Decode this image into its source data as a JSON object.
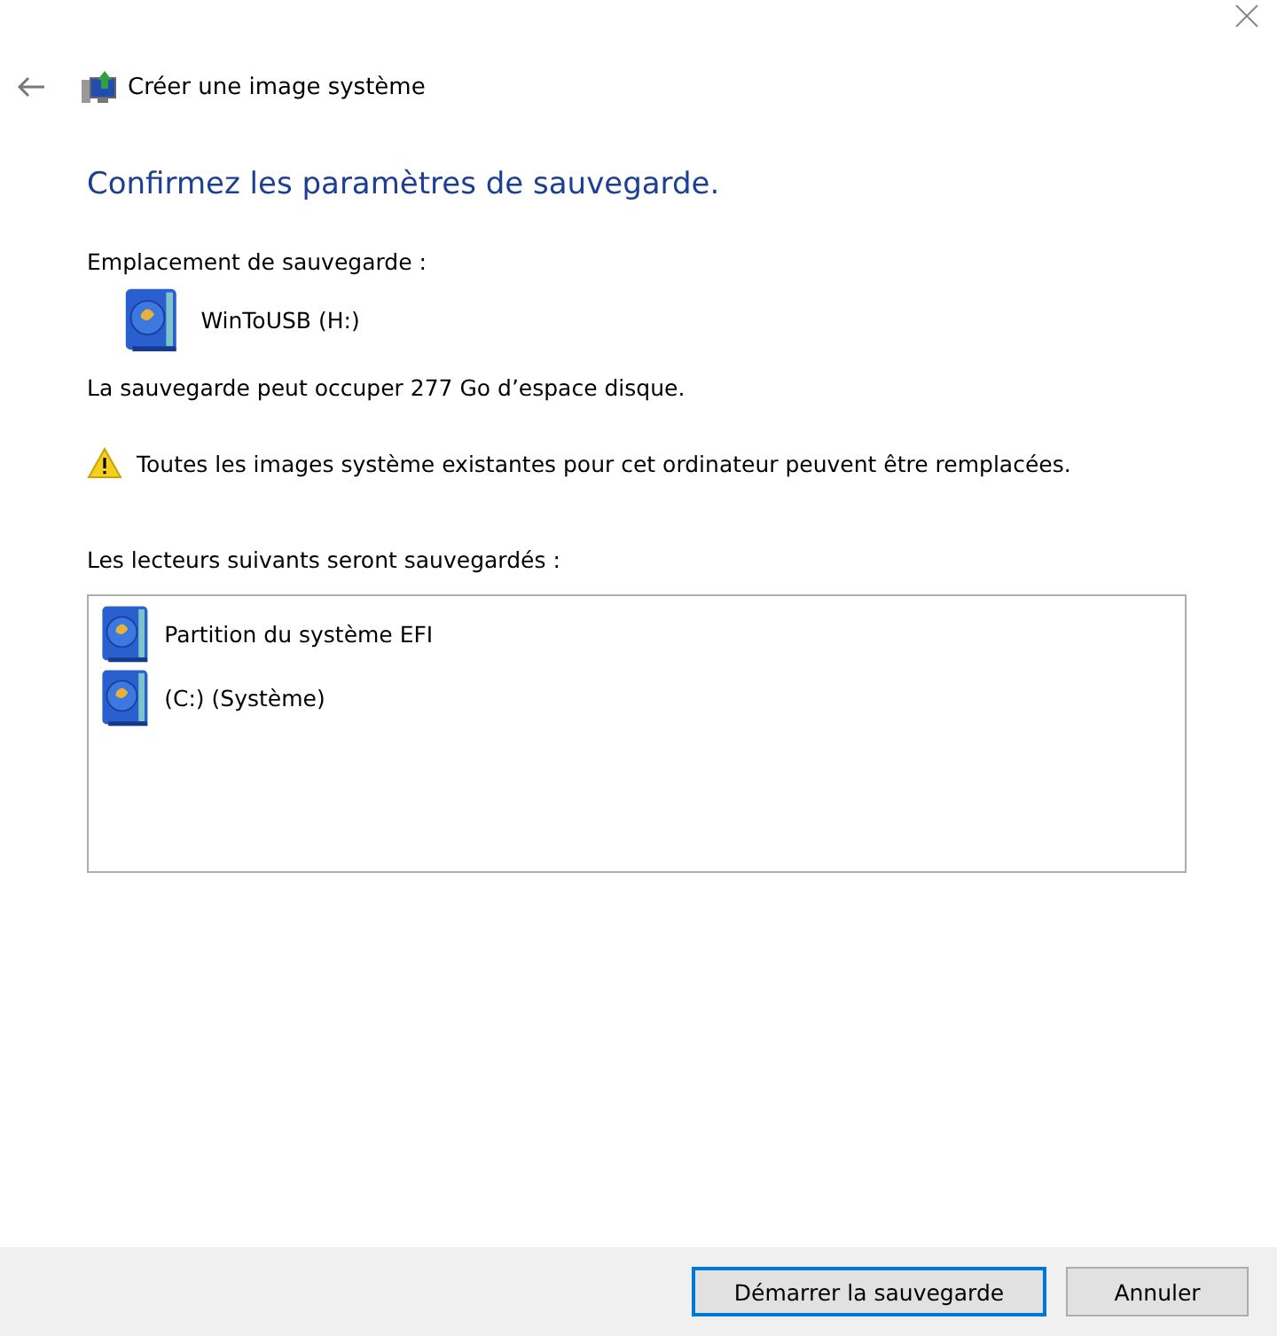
{
  "window": {
    "title": "Créer une image système"
  },
  "heading": "Confirmez les paramètres de sauvegarde.",
  "location": {
    "label": "Emplacement de sauvegarde :",
    "drive": "WinToUSB (H:)"
  },
  "space_note": "La sauvegarde peut occuper 277 Go d’espace disque.",
  "warning": "Toutes les images système existantes pour cet ordinateur peuvent être remplacées.",
  "drives": {
    "label": "Les lecteurs suivants seront sauvegardés :",
    "items": [
      {
        "name": "Partition du système EFI"
      },
      {
        "name": "(C:) (Système)"
      }
    ]
  },
  "buttons": [
    {
      "label": "Démarrer la sauvegarde",
      "default": true
    },
    {
      "label": "Annuler",
      "default": false
    }
  ]
}
